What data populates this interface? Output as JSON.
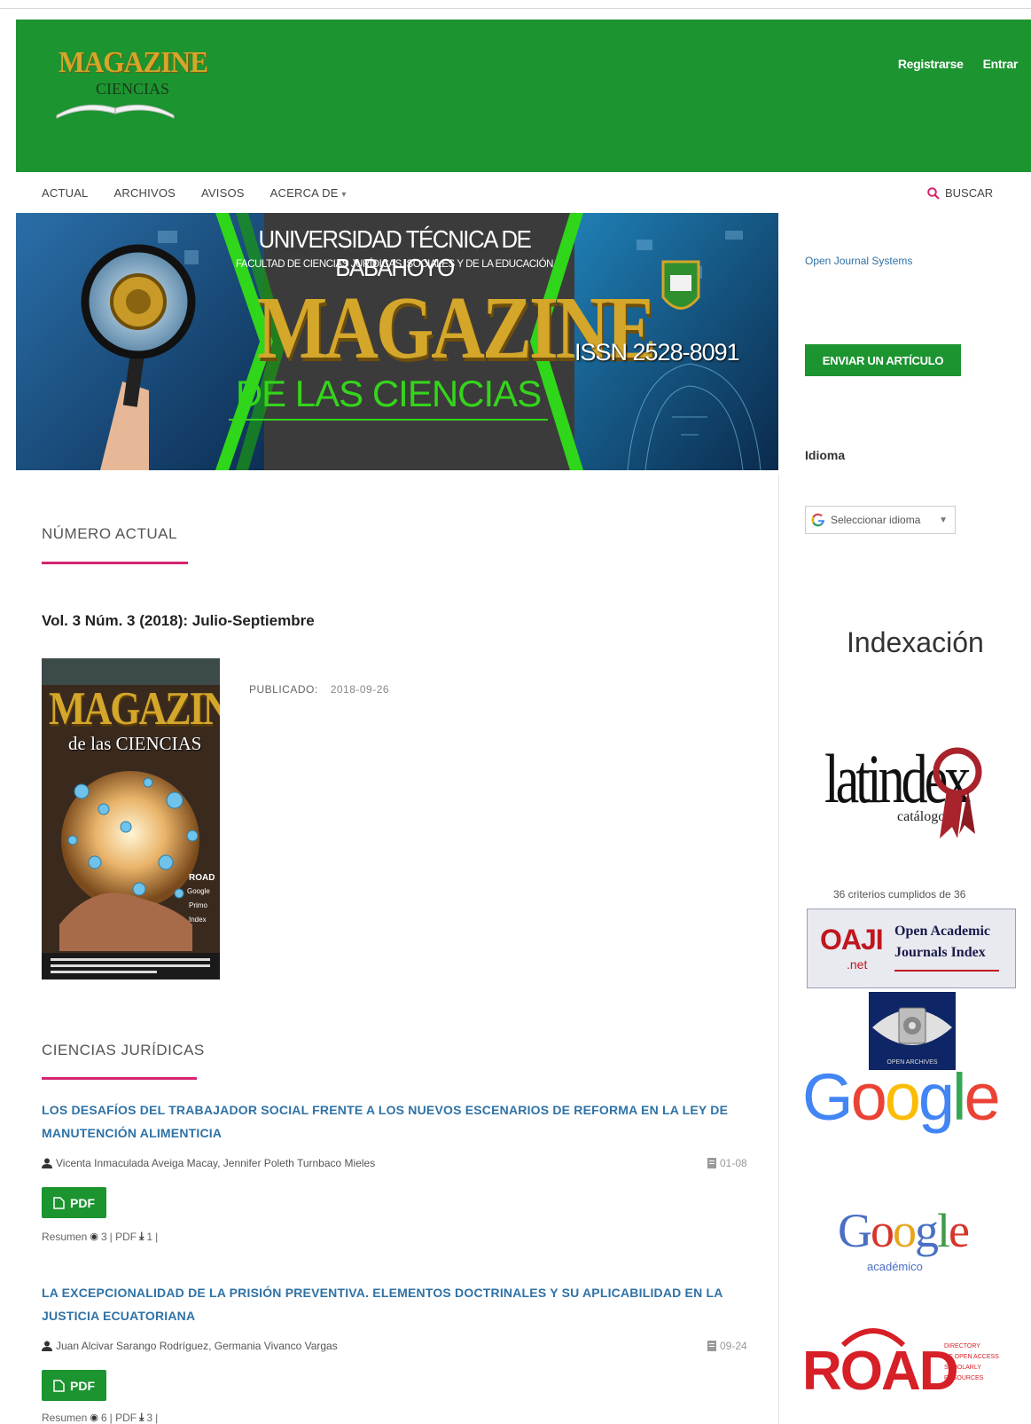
{
  "header": {
    "logo_line1": "MAGAZINE",
    "logo_line2": "CIENCIAS",
    "register": "Registrarse",
    "login": "Entrar"
  },
  "nav": {
    "items": [
      "ACTUAL",
      "ARCHIVOS",
      "AVISOS",
      "ACERCA DE"
    ],
    "about_caret": "▾",
    "search": "BUSCAR"
  },
  "banner": {
    "university": "UNIVERSIDAD TÉCNICA DE BABAHOYO",
    "faculty": "FACULTAD DE CIENCIAS JURÍDICAS, SOCIALES Y DE LA EDUCACIÓN",
    "title": "MAGAZINE",
    "subtitle": "DE LAS CIENCIAS",
    "issn": "ISSN 2528-8091"
  },
  "current": {
    "heading": "NÚMERO ACTUAL",
    "issue_title": "Vol. 3 Núm. 3 (2018): Julio-Septiembre",
    "published_label": "PUBLICADO:",
    "published_date": "2018-09-26",
    "cover": {
      "title": "MAGAZINE",
      "subtitle": "de las CIENCIAS",
      "side": [
        "ROAD",
        "Google",
        "Primo",
        "Index"
      ]
    }
  },
  "section": {
    "heading": "CIENCIAS JURÍDICAS",
    "articles": [
      {
        "title": "LOS DESAFÍOS DEL TRABAJADOR SOCIAL FRENTE A LOS NUEVOS ESCENARIOS DE REFORMA EN LA LEY DE MANUTENCIÓN ALIMENTICIA",
        "authors": "Vicenta Inmaculada Aveiga Macay, Jennifer Poleth Turnbaco Mieles",
        "pages": "01-08",
        "pdf": "PDF",
        "stats_resumen": "Resumen",
        "views": "3",
        "stats_pdf": "| PDF",
        "downloads": "1",
        "stats_end": "|"
      },
      {
        "title": "LA EXCEPCIONALIDAD DE LA PRISIÓN PREVENTIVA. ELEMENTOS DOCTRINALES Y SU APLICABILIDAD EN LA JUSTICIA ECUATORIANA",
        "authors": "Juan Alcivar Sarango Rodríguez, Germania Vivanco Vargas",
        "pages": "09-24",
        "pdf": "PDF",
        "stats_resumen": "Resumen",
        "views": "6",
        "stats_pdf": "| PDF",
        "downloads": "3",
        "stats_end": "|"
      }
    ]
  },
  "sidebar": {
    "ojs_link": "Open Journal Systems",
    "submit": "ENVIAR UN ARTÍCULO",
    "language_heading": "Idioma",
    "language_select": "Seleccionar idioma",
    "indexing_heading": "Indexación",
    "latindex_text": "latindex",
    "latindex_sub": "catálogo",
    "criteria": "36 criterios cumplidos de 36",
    "oaji_logo": "OAJI",
    "oaji_net": ".net",
    "oaji_name1": "Open Academic",
    "oaji_name2": "Journals Index",
    "open_archives": "OPEN ARCHIVES",
    "google": "Google",
    "scholar": "Google",
    "scholar_sub": "académico",
    "road": "ROAD",
    "road_sub": [
      "DIRECTORY",
      "OF OPEN ACCESS",
      "SCHOLARLY",
      "RESOURCES"
    ]
  },
  "colors": {
    "brand_green": "#1c9430",
    "accent_pink": "#d6246e",
    "link_blue": "#2f72a6"
  }
}
